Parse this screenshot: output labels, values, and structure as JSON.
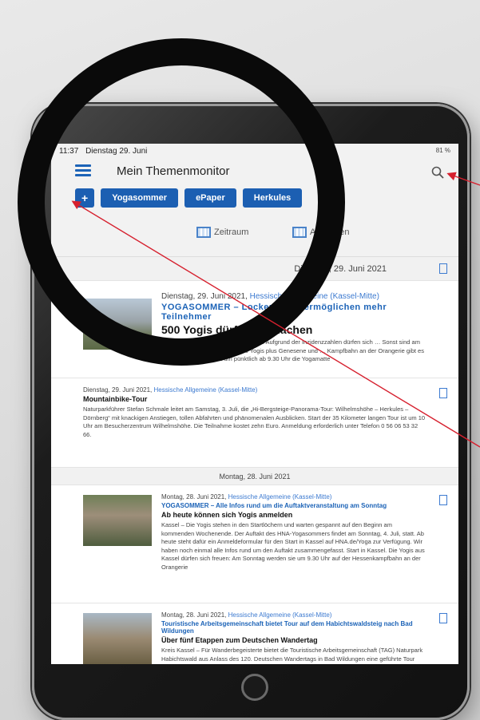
{
  "status": {
    "time": "11:37",
    "date": "Dienstag 29. Juni",
    "battery": "81 %"
  },
  "app": {
    "title": "Mein Themenmonitor"
  },
  "chips": [
    "+",
    "Yogasommer",
    "ePaper",
    "Herkules"
  ],
  "filters": {
    "period": "Zeitraum",
    "editions": "Ausgaben"
  },
  "sections": [
    {
      "date": "Dienstag, 29. Juni 2021",
      "articles": [
        {
          "meta_date": "Dienstag, 29. Juni 2021,",
          "meta_source": "Hessische Allgemeine (Kassel-Mitte)",
          "topic": "YOGASOMMER – Lockerungen ermöglichen mehr Teilnehmer",
          "headline": "500 Yogis dürfen mitmachen",
          "body": "Kassel – Solange … Yogis aus Kassel. Aufgrund der Inzidenzzahlen dürfen sich … Sonst sind am Sonntag, 4. Juli, mindestens 500 Yogis plus Genesene und … Kampfbahn an der Orangerie gibt es genügend Platz … und um pünktlich ab 9.30 Uhr die Yogamatte"
        },
        {
          "meta_date": "Dienstag, 29. Juni 2021,",
          "meta_source": "Hessische Allgemeine (Kassel-Mitte)",
          "topic": "",
          "headline": "Mountainbike-Tour",
          "body": "Naturparkführer Stefan Schmale leitet am Samstag, 3. Juli, die „Hi-Bergsteige-Panorama-Tour: Wilhelmshöhe – Herkules – Dörnberg“ mit knackigen Anstiegen, tollen Abfahrten und phänomenalen Ausblicken. Start der 35 Kilometer langen Tour ist um 10 Uhr am Besucherzentrum Wilhelmshöhe. Die Teilnahme kostet zehn Euro. Anmeldung erforderlich unter Telefon 0 56 06 53 32 66."
        }
      ]
    },
    {
      "date": "Montag, 28. Juni 2021",
      "articles": [
        {
          "meta_date": "Montag, 28. Juni 2021,",
          "meta_source": "Hessische Allgemeine (Kassel-Mitte)",
          "topic": "YOGASOMMER – Alle Infos rund um die Auftaktveranstaltung am Sonntag",
          "headline": "Ab heute können sich Yogis anmelden",
          "body": "Kassel – Die Yogis stehen in den Startlöchern und warten gespannt auf den Beginn am kommenden Wochenende. Der Auftakt des HNA-Yogasommers findet am Sonntag, 4. Juli, statt. Ab heute steht dafür ein Anmeldeformular für den Start in Kassel auf HNA.de/Yoga zur Verfügung. Wir haben noch einmal alle Infos rund um den Auftakt zusammengefasst. Start in Kassel. Die Yogis aus Kassel dürfen sich freuen: Am Sonntag werden sie um 9.30 Uhr auf der Hessenkampfbahn an der Orangerie"
        },
        {
          "meta_date": "Montag, 28. Juni 2021,",
          "meta_source": "Hessische Allgemeine (Kassel-Mitte)",
          "topic": "Touristische Arbeitsgemeinschaft bietet Tour auf dem Habichtswaldsteig nach Bad Wildungen",
          "headline": "Über fünf Etappen zum Deutschen Wandertag",
          "body": "Kreis Kassel – Für Wanderbegeisterte bietet die Touristische Arbeitsgemeinschaft (TAG) Naturpark Habichtswald aus Anlass des 120. Deutschen Wandertags in Bad Wildungen eine geführte Tour über den Habichtswaldsteig bis nach Bad Wildungen an. Vom Herkules aus"
        }
      ]
    }
  ]
}
